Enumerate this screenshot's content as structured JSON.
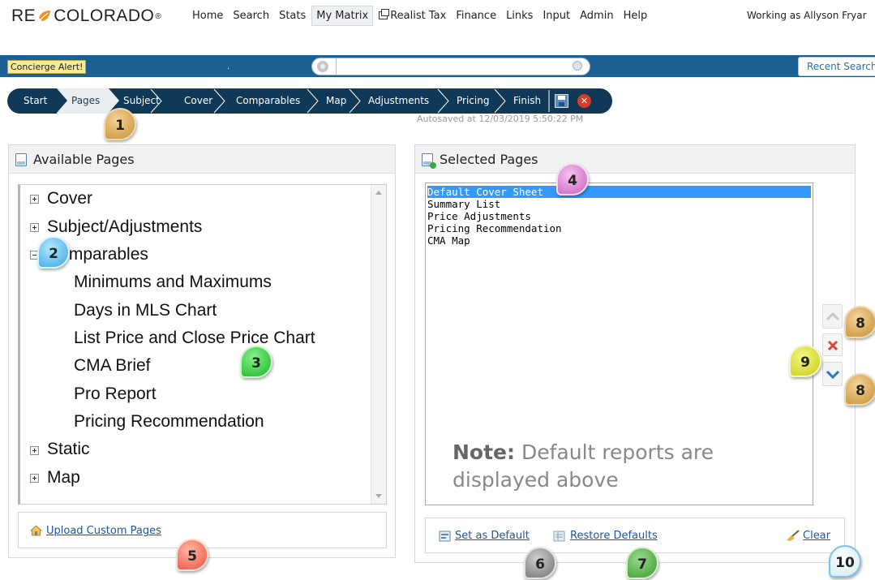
{
  "brand": {
    "logo_text_left": "RE",
    "logo_text_right": "COLORADO"
  },
  "topnav": {
    "items": [
      "Home",
      "Search",
      "Stats",
      "My Matrix",
      "Realist Tax",
      "Finance",
      "Links",
      "Input",
      "Admin",
      "Help"
    ],
    "active": "My Matrix",
    "working_as": "Working as Allyson Fryar"
  },
  "alertbar": {
    "concierge_label": "Concierge Alert!",
    "dot": ".",
    "search_value": "",
    "recent_label": "Recent Searches"
  },
  "wizard": {
    "steps": [
      "Start",
      "Pages",
      "Subject",
      "Cover",
      "Comparables",
      "Map",
      "Adjustments",
      "Pricing",
      "Finish"
    ],
    "active_step": "Pages",
    "autosaved": "Autosaved at 12/03/2019 5:50:22 PM"
  },
  "available_pages": {
    "title": "Available Pages",
    "tree": {
      "cover": "Cover",
      "subject": "Subject/Adjustments",
      "comparables": "Comparables",
      "comp_children": [
        "Minimums and Maximums",
        "Days in MLS Chart",
        "List Price and Close Price Chart",
        "CMA Brief",
        "Pro Report",
        "Pricing Recommendation"
      ],
      "static": "Static",
      "map": "Map"
    },
    "upload_link": "Upload Custom Pages"
  },
  "selected_pages": {
    "title": "Selected Pages",
    "items": [
      "Default Cover Sheet",
      "Summary List",
      "Price Adjustments",
      "Pricing Recommendation",
      "CMA Map"
    ],
    "selected_index": 0,
    "note_bold": "Note:",
    "note_text": "Default reports are displayed above",
    "set_default": "Set as Default",
    "restore_defaults": "Restore Defaults",
    "clear": "Clear"
  },
  "callouts": [
    "1",
    "2",
    "3",
    "4",
    "5",
    "6",
    "7",
    "8",
    "8",
    "9",
    "10"
  ],
  "colors": {
    "navy": "#0f3957",
    "alert_blue": "#1c5f92",
    "link": "#1a55a6",
    "selection": "#3399ff"
  }
}
